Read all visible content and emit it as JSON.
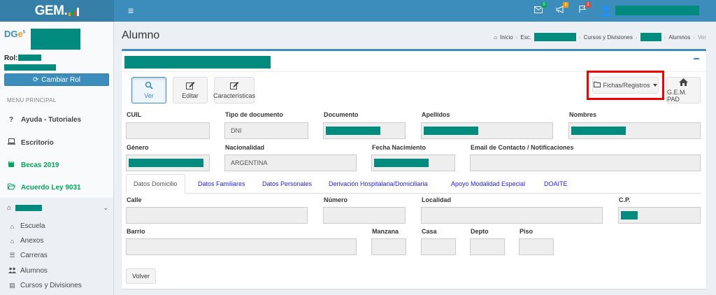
{
  "app": {
    "logo_text": "GEM."
  },
  "topbar": {
    "icons": [
      {
        "name": "envelope-icon",
        "badge": "0",
        "badge_color": "#00a65a"
      },
      {
        "name": "bullhorn-icon",
        "badge": "1",
        "badge_color": "#f39c12"
      },
      {
        "name": "flag-icon",
        "badge": "1",
        "badge_color": "#dd4b39"
      }
    ]
  },
  "sidebar": {
    "rol_label": "Rol:",
    "cambiar_rol": "Cambiar Rol",
    "menu_header": "MENU PRINCIPAL",
    "items": [
      {
        "label": "Ayuda - Tutoriales",
        "icon": "question-icon"
      },
      {
        "label": "Escritorio",
        "icon": "laptop-icon"
      },
      {
        "label": "Becas 2019",
        "icon": "book-icon",
        "color": "#00a65a"
      },
      {
        "label": "Acuerdo Ley 9031",
        "icon": "folder-open-icon",
        "color": "#00a65a"
      }
    ],
    "subitems": [
      {
        "label": "Escuela",
        "icon": "home-icon"
      },
      {
        "label": "Anexos",
        "icon": "home-icon"
      },
      {
        "label": "Carreras",
        "icon": "list-icon"
      },
      {
        "label": "Alumnos",
        "icon": "users-icon"
      },
      {
        "label": "Cursos y Divisiones",
        "icon": "list-alt-icon"
      }
    ]
  },
  "header": {
    "title": "Alumno",
    "breadcrumb": {
      "inicio": "Inicio",
      "esc": "Esc.",
      "cursos": "Cursos y Divisiones",
      "alumnos": "Alumnos",
      "ver": "Ver"
    }
  },
  "actions": {
    "ver": "Ver",
    "editar": "Editar",
    "caracteristicas": "Características",
    "fichas": "Fichas/Registros",
    "gem_pad": "G.E.M. PAD"
  },
  "form": {
    "labels": {
      "cuil": "CUIL",
      "tipo_documento": "Tipo de documento",
      "documento": "Documento",
      "apellidos": "Apellidos",
      "nombres": "Nombres",
      "genero": "Género",
      "nacionalidad": "Nacionalidad",
      "fecha_nacimiento": "Fecha Nacimiento",
      "email": "Email de Contacto / Notificaciones"
    },
    "values": {
      "tipo_documento": "DNI",
      "nacionalidad": "ARGENTINA"
    }
  },
  "tabs": [
    "Datos Domicilio",
    "Datos Familiares",
    "Datos Personales",
    "Derivación Hospitalaria/Domiciliaria",
    "Apoyo Modalidad Especial",
    "DOAITE"
  ],
  "domicilio": {
    "labels": {
      "calle": "Calle",
      "numero": "Número",
      "localidad": "Localidad",
      "cp": "C.P.",
      "barrio": "Barrio",
      "manzana": "Manzana",
      "casa": "Casa",
      "depto": "Depto",
      "piso": "Piso"
    }
  },
  "footer": {
    "volver": "Volver"
  },
  "colors": {
    "primary": "#3c8dbc",
    "redacted": "#008b7e",
    "highlight": "#ee0000",
    "success": "#00a65a"
  }
}
